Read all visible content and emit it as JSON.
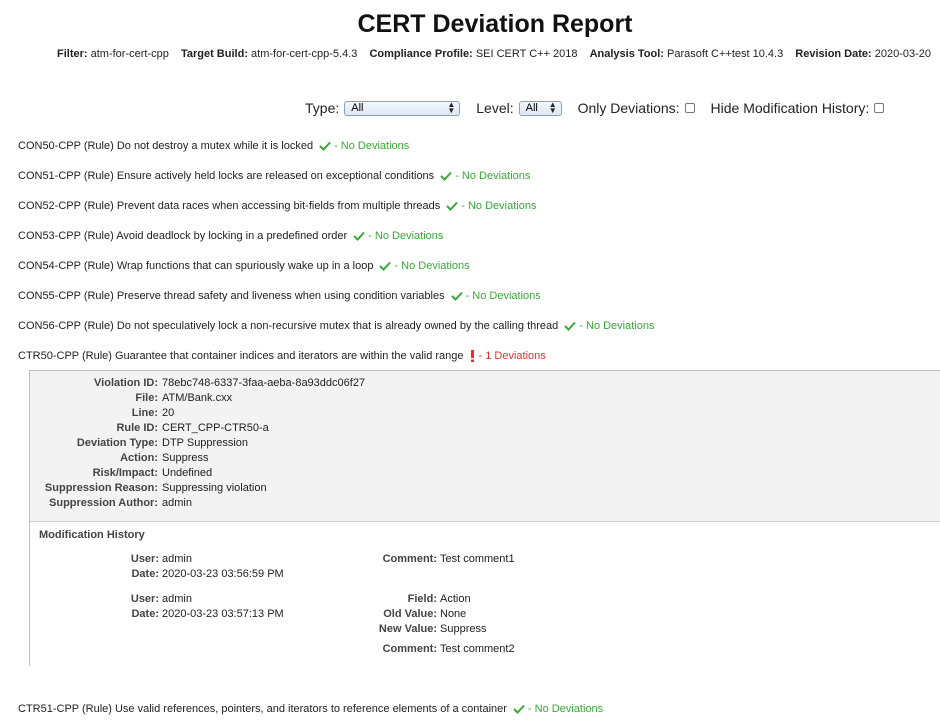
{
  "report": {
    "title": "CERT Deviation Report",
    "meta": [
      {
        "key": "Filter:",
        "value": "atm-for-cert-cpp"
      },
      {
        "key": "Target Build:",
        "value": "atm-for-cert-cpp-5.4.3"
      },
      {
        "key": "Compliance Profile:",
        "value": "SEI CERT C++ 2018"
      },
      {
        "key": "Analysis Tool:",
        "value": "Parasoft C++test 10.4.3"
      },
      {
        "key": "Revision Date:",
        "value": "2020-03-20"
      }
    ]
  },
  "filters": {
    "type_label": "Type:",
    "type_value": "All",
    "level_label": "Level:",
    "level_value": "All",
    "only_deviations_label": "Only Deviations:",
    "hide_history_label": "Hide Modification History:"
  },
  "rules": [
    {
      "text": "CON50-CPP (Rule) Do not destroy a mutex while it is locked",
      "status": "- No Deviations",
      "ok": true
    },
    {
      "text": "CON51-CPP (Rule) Ensure actively held locks are released on exceptional conditions",
      "status": "- No Deviations",
      "ok": true
    },
    {
      "text": "CON52-CPP (Rule) Prevent data races when accessing bit-fields from multiple threads",
      "status": "- No Deviations",
      "ok": true
    },
    {
      "text": "CON53-CPP (Rule) Avoid deadlock by locking in a predefined order",
      "status": "- No Deviations",
      "ok": true
    },
    {
      "text": "CON54-CPP (Rule) Wrap functions that can spuriously wake up in a loop",
      "status": "- No Deviations",
      "ok": true
    },
    {
      "text": "CON55-CPP (Rule) Preserve thread safety and liveness when using condition variables",
      "status": "- No Deviations",
      "ok": true
    },
    {
      "text": "CON56-CPP (Rule) Do not speculatively lock a non-recursive mutex that is already owned by the calling thread",
      "status": "- No Deviations",
      "ok": true
    },
    {
      "text": "CTR50-CPP (Rule) Guarantee that container indices and iterators are within the valid range",
      "status": "- 1 Deviations",
      "ok": false
    },
    {
      "text": "CTR51-CPP (Rule) Use valid references, pointers, and iterators to reference elements of a container",
      "status": "- No Deviations",
      "ok": true
    }
  ],
  "violation": {
    "fields": [
      {
        "key": "Violation ID:",
        "value": "78ebc748-6337-3faa-aeba-8a93ddc06f27"
      },
      {
        "key": "File:",
        "value": "ATM/Bank.cxx"
      },
      {
        "key": "Line:",
        "value": "20"
      },
      {
        "key": "Rule ID:",
        "value": "CERT_CPP-CTR50-a"
      },
      {
        "key": "Deviation Type:",
        "value": "DTP Suppression"
      },
      {
        "key": "Action:",
        "value": "Suppress"
      },
      {
        "key": "Risk/Impact:",
        "value": "Undefined"
      },
      {
        "key": "Suppression Reason:",
        "value": "Suppressing violation"
      },
      {
        "key": "Suppression Author:",
        "value": "admin"
      }
    ],
    "history_title": "Modification History",
    "history": [
      {
        "user_label": "User:",
        "user": "admin",
        "date_label": "Date:",
        "date": "2020-03-23 03:56:59 PM",
        "comment_label": "Comment:",
        "comment": "Test comment1"
      },
      {
        "user_label": "User:",
        "user": "admin",
        "date_label": "Date:",
        "date": "2020-03-23 03:57:13 PM",
        "field_label": "Field:",
        "field": "Action",
        "old_label": "Old Value:",
        "old": "None",
        "new_label": "New Value:",
        "new": "Suppress",
        "comment_label": "Comment:",
        "comment": "Test comment2"
      }
    ]
  },
  "colors": {
    "ok": "#3aa83a",
    "deviation": "#d9342b",
    "link": "#1a5a96"
  }
}
